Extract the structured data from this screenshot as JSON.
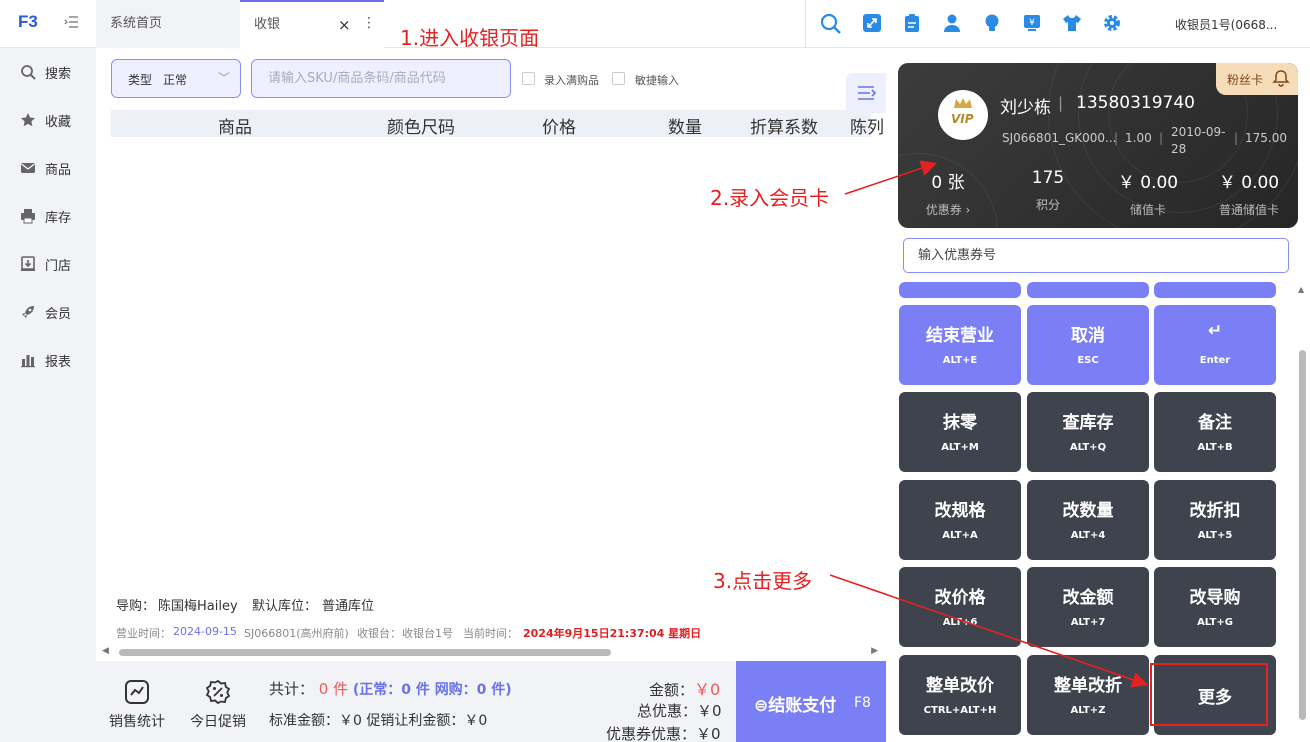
{
  "topbar": {
    "logo": "F3",
    "tabs": [
      {
        "label": "系统首页"
      },
      {
        "label": "收银"
      }
    ],
    "close_glyph": "×",
    "more_glyph": "⋮",
    "icons": [
      "search-icon",
      "expand-icon",
      "clipboard-icon",
      "user-icon",
      "bulb-icon",
      "yen-screen-icon",
      "shirt-icon",
      "gear-icon"
    ],
    "user": "收银员1号(0668..."
  },
  "annotations": {
    "step1": "1.进入收银页面",
    "step2": "2.录入会员卡",
    "step3": "3.点击更多"
  },
  "sidebar": {
    "items": [
      {
        "label": "搜索",
        "icon": "search-icon"
      },
      {
        "label": "收藏",
        "icon": "star-icon"
      },
      {
        "label": "商品",
        "icon": "mail-icon"
      },
      {
        "label": "库存",
        "icon": "printer-icon"
      },
      {
        "label": "门店",
        "icon": "store-icon"
      },
      {
        "label": "会员",
        "icon": "rocket-icon"
      },
      {
        "label": "报表",
        "icon": "bar-chart-icon"
      }
    ]
  },
  "main": {
    "type_label": "类型",
    "type_value": "正常",
    "sku_placeholder": "请输入SKU/商品条码/商品代码",
    "checkbox1": "录入满购品",
    "checkbox2": "敏捷输入",
    "columns": [
      "商品",
      "颜色尺码",
      "价格",
      "数量",
      "折算系数",
      "陈列"
    ],
    "guide_label": "导购：",
    "guide_value": "陈国梅Hailey",
    "loc_label": "默认库位：",
    "loc_value": "普通库位",
    "info": {
      "biz_time_label": "营业时间：",
      "biz_time": "2024-09-15",
      "store": "SJ066801(高州府前)",
      "till_label": "收银台：",
      "till": "收银台1号",
      "now_label": "当前时间：",
      "now": "2024年9月15日21:37:04 星期日"
    }
  },
  "bottom": {
    "sales_stats": "销售统计",
    "today_promo": "今日促销",
    "total_label": "共计：",
    "total_count": "0 件",
    "normal_part": "(正常：0 件",
    "online_part": "网购：0 件)",
    "std_amount": "标准金额：￥0  促销让利金额：￥0",
    "amount_label": "金额：",
    "amount_value": "￥0",
    "total_discount_label": "总优惠：",
    "total_discount_value": "￥0",
    "coupon_discount_label": "优惠券优惠：",
    "coupon_discount_value": "￥0",
    "checkout_label": "结账支付",
    "checkout_key": "F8"
  },
  "vip": {
    "badge": "VIP",
    "name": "刘少栋",
    "sep": "|",
    "phone": "13580319740",
    "card_no": "SJ066801_GK000...",
    "rate": "1.00",
    "date": "2010-09-28",
    "level_value": "175.00",
    "tag": "粉丝卡",
    "stats": [
      {
        "value": "0 张",
        "label": "优惠券 ›"
      },
      {
        "value": "175",
        "label": "积分"
      },
      {
        "value": "￥ 0.00",
        "label": "储值卡"
      },
      {
        "value": "￥ 0.00",
        "label": "普通储值卡"
      }
    ]
  },
  "coupon_input_label": "输入优惠券号",
  "function_buttons": [
    {
      "label": "结束营业",
      "key": "ALT+E"
    },
    {
      "label": "取消",
      "key": "ESC"
    },
    {
      "label": "↵",
      "key": "Enter"
    },
    {
      "label": "抹零",
      "key": "ALT+M"
    },
    {
      "label": "查库存",
      "key": "ALT+Q"
    },
    {
      "label": "备注",
      "key": "ALT+B"
    },
    {
      "label": "改规格",
      "key": "ALT+A"
    },
    {
      "label": "改数量",
      "key": "ALT+4"
    },
    {
      "label": "改折扣",
      "key": "ALT+5"
    },
    {
      "label": "改价格",
      "key": "ALT+6"
    },
    {
      "label": "改金额",
      "key": "ALT+7"
    },
    {
      "label": "改导购",
      "key": "ALT+G"
    },
    {
      "label": "整单改价",
      "key": "CTRL+ALT+H"
    },
    {
      "label": "整单改折",
      "key": "ALT+Z"
    },
    {
      "label": "更多",
      "key": ""
    }
  ],
  "colors": {
    "accent": "#7b7ff5",
    "dark_button": "#3e434d",
    "annotation": "#e52222"
  }
}
